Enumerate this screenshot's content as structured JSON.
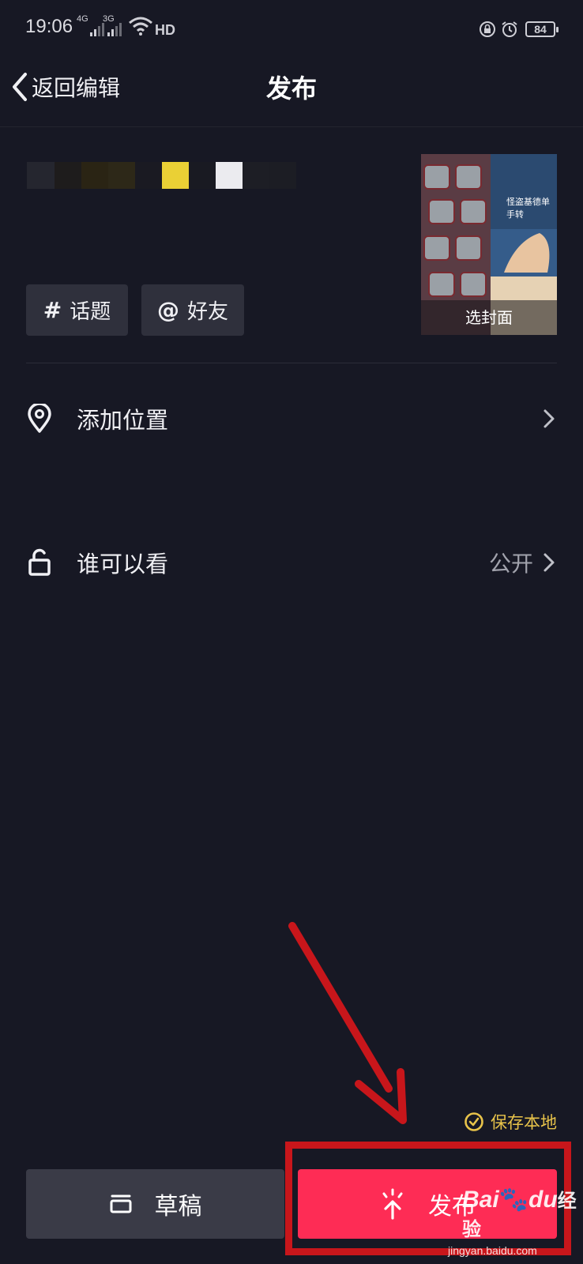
{
  "status_bar": {
    "time": "19:06",
    "net1": "4G",
    "net2": "3G",
    "hd": "HD",
    "battery": "84"
  },
  "nav": {
    "back_label": "返回编辑",
    "title": "发布"
  },
  "cover": {
    "label": "选封面",
    "overlay_text": "怪盗基德单手转"
  },
  "chips": {
    "topic": {
      "symbol": "#",
      "label": "话题"
    },
    "friend": {
      "symbol": "@",
      "label": "好友"
    }
  },
  "rows": {
    "location": {
      "label": "添加位置",
      "icon": "location-pin-icon"
    },
    "visibility": {
      "label": "谁可以看",
      "value": "公开",
      "icon": "unlock-icon"
    }
  },
  "save_local": {
    "label": "保存本地",
    "icon": "check-circle-icon"
  },
  "buttons": {
    "draft": {
      "label": "草稿",
      "icon": "draft-box-icon"
    },
    "publish": {
      "label": "发布",
      "icon": "upload-sparkle-icon"
    }
  },
  "watermark": {
    "brand": "Bai",
    "brand2": "du",
    "cn": "经验",
    "url": "jingyan.baidu.com"
  },
  "colors": {
    "background": "#171824",
    "publish": "#fe2c55",
    "save_local": "#e8c34a",
    "annotation": "#c8161b"
  }
}
